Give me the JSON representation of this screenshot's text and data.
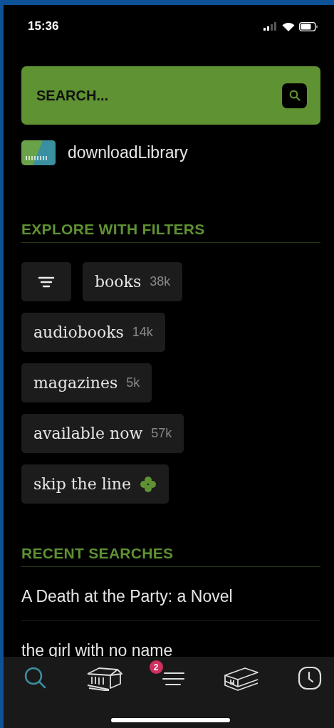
{
  "status_bar": {
    "time": "15:36"
  },
  "search": {
    "placeholder": "SEARCH..."
  },
  "library": {
    "name": "downloadLibrary"
  },
  "filters": {
    "title": "EXPLORE WITH FILTERS",
    "chips": [
      {
        "kind": "menu"
      },
      {
        "kind": "count",
        "label": "books",
        "count": "38k"
      },
      {
        "kind": "count",
        "label": "audiobooks",
        "count": "14k"
      },
      {
        "kind": "count",
        "label": "magazines",
        "count": "5k"
      },
      {
        "kind": "count",
        "label": "available now",
        "count": "57k"
      },
      {
        "kind": "clover",
        "label": "skip the line"
      }
    ]
  },
  "recent_searches": {
    "title": "RECENT SEARCHES",
    "items": [
      "A Death at the Party: a Novel",
      "the girl with no name"
    ]
  },
  "tab_bar": [
    {
      "kind": "search",
      "selected": true
    },
    {
      "kind": "library",
      "selected": false
    },
    {
      "kind": "menu",
      "selected": false,
      "badge": "2"
    },
    {
      "kind": "shelf",
      "selected": false
    },
    {
      "kind": "history",
      "selected": false
    }
  ]
}
